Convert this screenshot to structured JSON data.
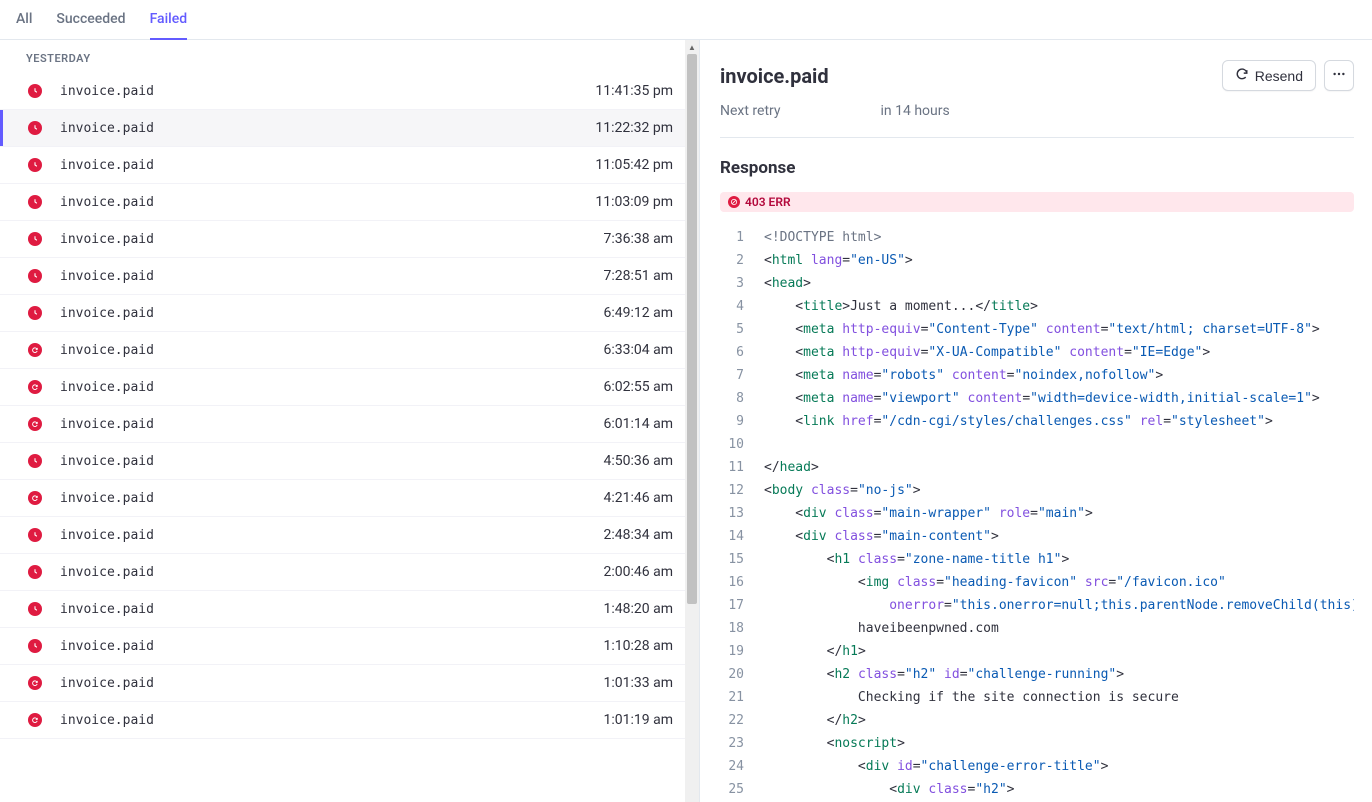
{
  "tabs": [
    {
      "label": "All",
      "active": false
    },
    {
      "label": "Succeeded",
      "active": false
    },
    {
      "label": "Failed",
      "active": true
    }
  ],
  "group_label": "YESTERDAY",
  "events": [
    {
      "name": "invoice.paid",
      "time": "11:41:35 pm",
      "icon": "clock",
      "selected": false
    },
    {
      "name": "invoice.paid",
      "time": "11:22:32 pm",
      "icon": "clock",
      "selected": true
    },
    {
      "name": "invoice.paid",
      "time": "11:05:42 pm",
      "icon": "clock",
      "selected": false
    },
    {
      "name": "invoice.paid",
      "time": "11:03:09 pm",
      "icon": "clock",
      "selected": false
    },
    {
      "name": "invoice.paid",
      "time": "7:36:38 am",
      "icon": "clock",
      "selected": false
    },
    {
      "name": "invoice.paid",
      "time": "7:28:51 am",
      "icon": "clock",
      "selected": false
    },
    {
      "name": "invoice.paid",
      "time": "6:49:12 am",
      "icon": "clock",
      "selected": false
    },
    {
      "name": "invoice.paid",
      "time": "6:33:04 am",
      "icon": "retry",
      "selected": false
    },
    {
      "name": "invoice.paid",
      "time": "6:02:55 am",
      "icon": "retry",
      "selected": false
    },
    {
      "name": "invoice.paid",
      "time": "6:01:14 am",
      "icon": "retry",
      "selected": false
    },
    {
      "name": "invoice.paid",
      "time": "4:50:36 am",
      "icon": "clock",
      "selected": false
    },
    {
      "name": "invoice.paid",
      "time": "4:21:46 am",
      "icon": "retry",
      "selected": false
    },
    {
      "name": "invoice.paid",
      "time": "2:48:34 am",
      "icon": "clock",
      "selected": false
    },
    {
      "name": "invoice.paid",
      "time": "2:00:46 am",
      "icon": "clock",
      "selected": false
    },
    {
      "name": "invoice.paid",
      "time": "1:48:20 am",
      "icon": "clock",
      "selected": false
    },
    {
      "name": "invoice.paid",
      "time": "1:10:28 am",
      "icon": "clock",
      "selected": false
    },
    {
      "name": "invoice.paid",
      "time": "1:01:33 am",
      "icon": "retry",
      "selected": false
    },
    {
      "name": "invoice.paid",
      "time": "1:01:19 am",
      "icon": "retry",
      "selected": false
    }
  ],
  "detail": {
    "title": "invoice.paid",
    "resend_label": "Resend",
    "next_retry_label": "Next retry",
    "next_retry_value": "in 14 hours",
    "response_label": "Response",
    "status_badge": "403 ERR",
    "code_lines": [
      [
        {
          "t": "doctype",
          "v": "<!DOCTYPE html>"
        }
      ],
      [
        {
          "t": "punc",
          "v": "<"
        },
        {
          "t": "tag",
          "v": "html"
        },
        {
          "t": "punc",
          "v": " "
        },
        {
          "t": "attr",
          "v": "lang"
        },
        {
          "t": "punc",
          "v": "="
        },
        {
          "t": "str",
          "v": "\"en-US\""
        },
        {
          "t": "punc",
          "v": ">"
        }
      ],
      [
        {
          "t": "punc",
          "v": "<"
        },
        {
          "t": "tag",
          "v": "head"
        },
        {
          "t": "punc",
          "v": ">"
        }
      ],
      [
        {
          "t": "punc",
          "v": "    <"
        },
        {
          "t": "tag",
          "v": "title"
        },
        {
          "t": "punc",
          "v": ">"
        },
        {
          "t": "text",
          "v": "Just a moment..."
        },
        {
          "t": "punc",
          "v": "</"
        },
        {
          "t": "tag",
          "v": "title"
        },
        {
          "t": "punc",
          "v": ">"
        }
      ],
      [
        {
          "t": "punc",
          "v": "    <"
        },
        {
          "t": "tag",
          "v": "meta"
        },
        {
          "t": "punc",
          "v": " "
        },
        {
          "t": "attr",
          "v": "http-equiv"
        },
        {
          "t": "punc",
          "v": "="
        },
        {
          "t": "str",
          "v": "\"Content-Type\""
        },
        {
          "t": "punc",
          "v": " "
        },
        {
          "t": "attr",
          "v": "content"
        },
        {
          "t": "punc",
          "v": "="
        },
        {
          "t": "str",
          "v": "\"text/html; charset=UTF-8\""
        },
        {
          "t": "punc",
          "v": ">"
        }
      ],
      [
        {
          "t": "punc",
          "v": "    <"
        },
        {
          "t": "tag",
          "v": "meta"
        },
        {
          "t": "punc",
          "v": " "
        },
        {
          "t": "attr",
          "v": "http-equiv"
        },
        {
          "t": "punc",
          "v": "="
        },
        {
          "t": "str",
          "v": "\"X-UA-Compatible\""
        },
        {
          "t": "punc",
          "v": " "
        },
        {
          "t": "attr",
          "v": "content"
        },
        {
          "t": "punc",
          "v": "="
        },
        {
          "t": "str",
          "v": "\"IE=Edge\""
        },
        {
          "t": "punc",
          "v": ">"
        }
      ],
      [
        {
          "t": "punc",
          "v": "    <"
        },
        {
          "t": "tag",
          "v": "meta"
        },
        {
          "t": "punc",
          "v": " "
        },
        {
          "t": "attr",
          "v": "name"
        },
        {
          "t": "punc",
          "v": "="
        },
        {
          "t": "str",
          "v": "\"robots\""
        },
        {
          "t": "punc",
          "v": " "
        },
        {
          "t": "attr",
          "v": "content"
        },
        {
          "t": "punc",
          "v": "="
        },
        {
          "t": "str",
          "v": "\"noindex,nofollow\""
        },
        {
          "t": "punc",
          "v": ">"
        }
      ],
      [
        {
          "t": "punc",
          "v": "    <"
        },
        {
          "t": "tag",
          "v": "meta"
        },
        {
          "t": "punc",
          "v": " "
        },
        {
          "t": "attr",
          "v": "name"
        },
        {
          "t": "punc",
          "v": "="
        },
        {
          "t": "str",
          "v": "\"viewport\""
        },
        {
          "t": "punc",
          "v": " "
        },
        {
          "t": "attr",
          "v": "content"
        },
        {
          "t": "punc",
          "v": "="
        },
        {
          "t": "str",
          "v": "\"width=device-width,initial-scale=1\""
        },
        {
          "t": "punc",
          "v": ">"
        }
      ],
      [
        {
          "t": "punc",
          "v": "    <"
        },
        {
          "t": "tag",
          "v": "link"
        },
        {
          "t": "punc",
          "v": " "
        },
        {
          "t": "attr",
          "v": "href"
        },
        {
          "t": "punc",
          "v": "="
        },
        {
          "t": "str",
          "v": "\"/cdn-cgi/styles/challenges.css\""
        },
        {
          "t": "punc",
          "v": " "
        },
        {
          "t": "attr",
          "v": "rel"
        },
        {
          "t": "punc",
          "v": "="
        },
        {
          "t": "str",
          "v": "\"stylesheet\""
        },
        {
          "t": "punc",
          "v": ">"
        }
      ],
      [],
      [
        {
          "t": "punc",
          "v": "</"
        },
        {
          "t": "tag",
          "v": "head"
        },
        {
          "t": "punc",
          "v": ">"
        }
      ],
      [
        {
          "t": "punc",
          "v": "<"
        },
        {
          "t": "tag",
          "v": "body"
        },
        {
          "t": "punc",
          "v": " "
        },
        {
          "t": "attr",
          "v": "class"
        },
        {
          "t": "punc",
          "v": "="
        },
        {
          "t": "str",
          "v": "\"no-js\""
        },
        {
          "t": "punc",
          "v": ">"
        }
      ],
      [
        {
          "t": "punc",
          "v": "    <"
        },
        {
          "t": "tag",
          "v": "div"
        },
        {
          "t": "punc",
          "v": " "
        },
        {
          "t": "attr",
          "v": "class"
        },
        {
          "t": "punc",
          "v": "="
        },
        {
          "t": "str",
          "v": "\"main-wrapper\""
        },
        {
          "t": "punc",
          "v": " "
        },
        {
          "t": "attr",
          "v": "role"
        },
        {
          "t": "punc",
          "v": "="
        },
        {
          "t": "str",
          "v": "\"main\""
        },
        {
          "t": "punc",
          "v": ">"
        }
      ],
      [
        {
          "t": "punc",
          "v": "    <"
        },
        {
          "t": "tag",
          "v": "div"
        },
        {
          "t": "punc",
          "v": " "
        },
        {
          "t": "attr",
          "v": "class"
        },
        {
          "t": "punc",
          "v": "="
        },
        {
          "t": "str",
          "v": "\"main-content\""
        },
        {
          "t": "punc",
          "v": ">"
        }
      ],
      [
        {
          "t": "punc",
          "v": "        <"
        },
        {
          "t": "tag",
          "v": "h1"
        },
        {
          "t": "punc",
          "v": " "
        },
        {
          "t": "attr",
          "v": "class"
        },
        {
          "t": "punc",
          "v": "="
        },
        {
          "t": "str",
          "v": "\"zone-name-title h1\""
        },
        {
          "t": "punc",
          "v": ">"
        }
      ],
      [
        {
          "t": "punc",
          "v": "            <"
        },
        {
          "t": "tag",
          "v": "img"
        },
        {
          "t": "punc",
          "v": " "
        },
        {
          "t": "attr",
          "v": "class"
        },
        {
          "t": "punc",
          "v": "="
        },
        {
          "t": "str",
          "v": "\"heading-favicon\""
        },
        {
          "t": "punc",
          "v": " "
        },
        {
          "t": "attr",
          "v": "src"
        },
        {
          "t": "punc",
          "v": "="
        },
        {
          "t": "str",
          "v": "\"/favicon.ico\""
        }
      ],
      [
        {
          "t": "punc",
          "v": "                "
        },
        {
          "t": "attr",
          "v": "onerror"
        },
        {
          "t": "punc",
          "v": "="
        },
        {
          "t": "str",
          "v": "\"this.onerror=null;this.parentNode.removeChild(this)\""
        },
        {
          "t": "punc",
          "v": ">"
        }
      ],
      [
        {
          "t": "text",
          "v": "            haveibeenpwned.com"
        }
      ],
      [
        {
          "t": "punc",
          "v": "        </"
        },
        {
          "t": "tag",
          "v": "h1"
        },
        {
          "t": "punc",
          "v": ">"
        }
      ],
      [
        {
          "t": "punc",
          "v": "        <"
        },
        {
          "t": "tag",
          "v": "h2"
        },
        {
          "t": "punc",
          "v": " "
        },
        {
          "t": "attr",
          "v": "class"
        },
        {
          "t": "punc",
          "v": "="
        },
        {
          "t": "str",
          "v": "\"h2\""
        },
        {
          "t": "punc",
          "v": " "
        },
        {
          "t": "attr",
          "v": "id"
        },
        {
          "t": "punc",
          "v": "="
        },
        {
          "t": "str",
          "v": "\"challenge-running\""
        },
        {
          "t": "punc",
          "v": ">"
        }
      ],
      [
        {
          "t": "text",
          "v": "            Checking if the site connection is secure"
        }
      ],
      [
        {
          "t": "punc",
          "v": "        </"
        },
        {
          "t": "tag",
          "v": "h2"
        },
        {
          "t": "punc",
          "v": ">"
        }
      ],
      [
        {
          "t": "punc",
          "v": "        <"
        },
        {
          "t": "tag",
          "v": "noscript"
        },
        {
          "t": "punc",
          "v": ">"
        }
      ],
      [
        {
          "t": "punc",
          "v": "            <"
        },
        {
          "t": "tag",
          "v": "div"
        },
        {
          "t": "punc",
          "v": " "
        },
        {
          "t": "attr",
          "v": "id"
        },
        {
          "t": "punc",
          "v": "="
        },
        {
          "t": "str",
          "v": "\"challenge-error-title\""
        },
        {
          "t": "punc",
          "v": ">"
        }
      ],
      [
        {
          "t": "punc",
          "v": "                <"
        },
        {
          "t": "tag",
          "v": "div"
        },
        {
          "t": "punc",
          "v": " "
        },
        {
          "t": "attr",
          "v": "class"
        },
        {
          "t": "punc",
          "v": "="
        },
        {
          "t": "str",
          "v": "\"h2\""
        },
        {
          "t": "punc",
          "v": ">"
        }
      ]
    ]
  }
}
